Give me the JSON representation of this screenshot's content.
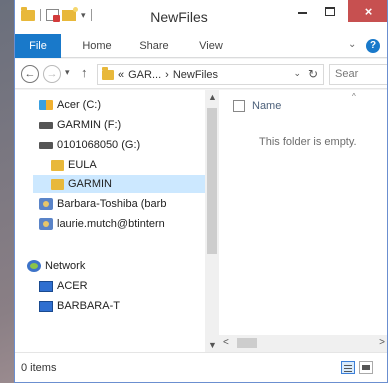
{
  "window": {
    "title": "NewFiles",
    "close_symbol": "×"
  },
  "ribbon": {
    "tabs": [
      {
        "label": "File"
      },
      {
        "label": "Home"
      },
      {
        "label": "Share"
      },
      {
        "label": "View"
      }
    ],
    "help_label": "?"
  },
  "address": {
    "prefix": "«",
    "crumb1": "GAR...",
    "crumb_sep": "›",
    "crumb2": "NewFiles",
    "search_placeholder": "Sear"
  },
  "nav_tree": {
    "items": [
      {
        "label": "Acer (C:)",
        "icon": "windows-drive-icon"
      },
      {
        "label": "GARMIN (F:)",
        "icon": "drive-icon"
      },
      {
        "label": "0101068050 (G:)",
        "icon": "drive-icon"
      },
      {
        "label": "EULA",
        "icon": "folder-icon"
      },
      {
        "label": "GARMIN",
        "icon": "folder-icon",
        "selected": true
      },
      {
        "label": "Barbara-Toshiba (barb",
        "icon": "homegroup-user-icon"
      },
      {
        "label": "laurie.mutch@btintern",
        "icon": "homegroup-user-icon"
      },
      {
        "label": "Network",
        "icon": "network-icon"
      },
      {
        "label": "ACER",
        "icon": "computer-icon"
      },
      {
        "label": "BARBARA-T",
        "icon": "computer-icon"
      }
    ]
  },
  "content": {
    "column_name": "Name",
    "empty_message": "This folder is empty."
  },
  "status": {
    "item_count": "0 items"
  },
  "colors": {
    "accent": "#1979ca",
    "close_button": "#c75050",
    "selection": "#cce8ff",
    "folder": "#e8b83a"
  }
}
